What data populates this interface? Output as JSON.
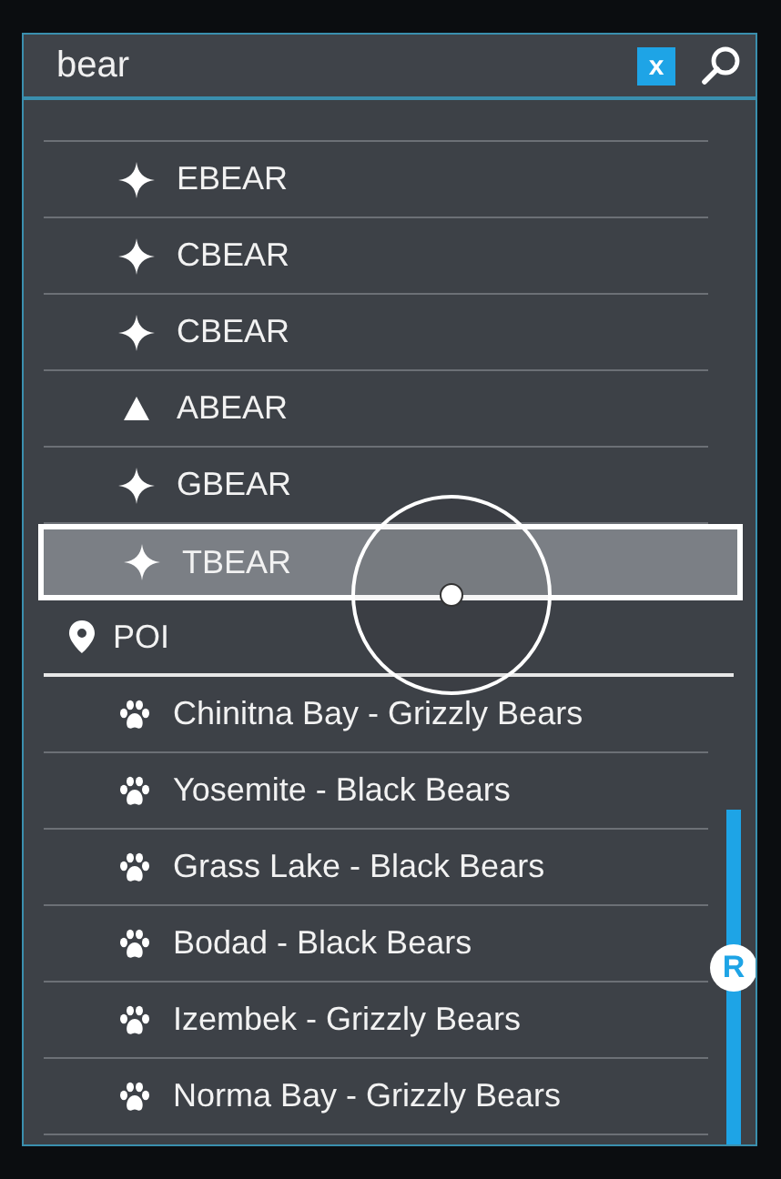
{
  "search": {
    "value": "bear",
    "clear_label": "x"
  },
  "results": [
    {
      "kind": "star",
      "label": "EBEAR",
      "selected": false
    },
    {
      "kind": "star",
      "label": "CBEAR",
      "selected": false
    },
    {
      "kind": "star",
      "label": "CBEAR",
      "selected": false
    },
    {
      "kind": "triangle",
      "label": "ABEAR",
      "selected": false
    },
    {
      "kind": "star",
      "label": "GBEAR",
      "selected": false
    },
    {
      "kind": "star",
      "label": "TBEAR",
      "selected": true
    }
  ],
  "section": {
    "label": "POI"
  },
  "poi": [
    {
      "kind": "paw",
      "label": "Chinitna Bay - Grizzly Bears",
      "selected": false
    },
    {
      "kind": "paw",
      "label": "Yosemite - Black Bears",
      "selected": false
    },
    {
      "kind": "paw",
      "label": "Grass Lake - Black Bears",
      "selected": false
    },
    {
      "kind": "paw",
      "label": "Bodad - Black Bears",
      "selected": false
    },
    {
      "kind": "paw",
      "label": "Izembek - Grizzly Bears",
      "selected": false
    },
    {
      "kind": "paw",
      "label": "Norma Bay - Grizzly Bears",
      "selected": false
    }
  ],
  "scroll_thumb_label": "R"
}
